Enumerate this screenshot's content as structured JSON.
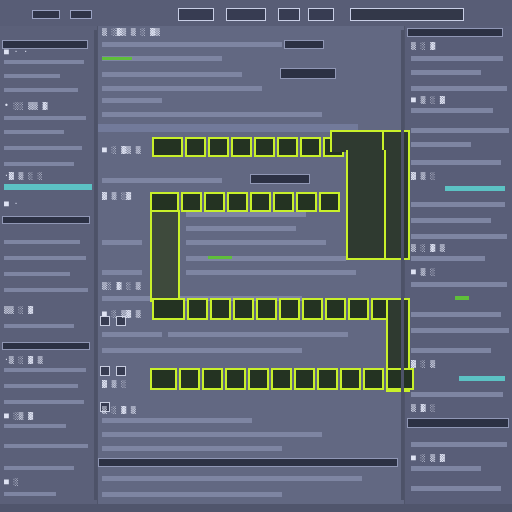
{
  "colors": {
    "background": "#5b617b",
    "accent": "#c8f02a",
    "text_light": "#dfe3f3",
    "text_green": "#8ee04a"
  },
  "left_panel": {
    "lines": [
      "■ · ·",
      "• ░░ ▒▒ ▓",
      "·▓ ▒ ░ ░",
      "■ ·",
      "▒▒ ░ ▓",
      "·▒ ░ ▓ ▒",
      "■ ░▒ ▓",
      "■ ░",
      "▓ ▒ ░"
    ]
  },
  "main_panel": {
    "lines": [
      "▒ ░▓▒ ▒ ░ ▓▒",
      "■ ░ ▓▒ ▒",
      "▓ ▒ ░▓",
      "▒░ ▓ ░ ▒",
      "■ ░ ▒▓ ▒",
      "▓ ▒ ░",
      "▒ ░ ▓ ▒",
      "■ ▒ ░▓"
    ]
  },
  "right_panel": {
    "lines": [
      "▒ ░ ▓",
      "■ ▒ ░ ▓",
      "▓ ▒ ░",
      "▒ ░ ▓ ▒",
      "■ ▒ ░",
      "▓ ░ ▒",
      "▒ ▓ ░",
      "■ ░ ▒ ▓",
      "▓ ▒"
    ]
  }
}
